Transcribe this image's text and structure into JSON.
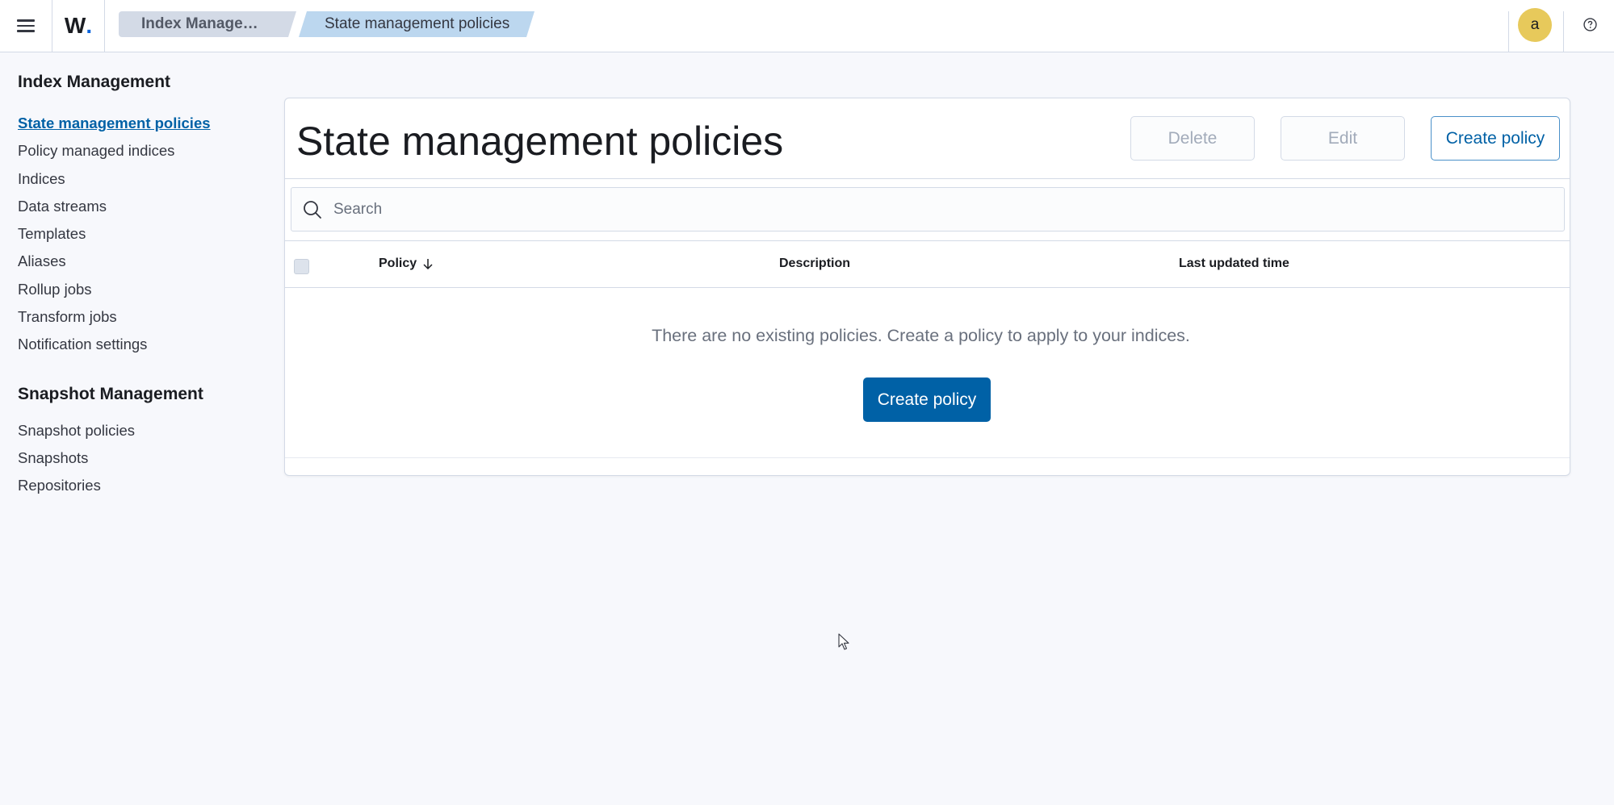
{
  "header": {
    "logo_text": "W",
    "logo_dot": ".",
    "breadcrumbs": [
      {
        "label": "Index Manage…"
      },
      {
        "label": "State management policies"
      }
    ],
    "avatar_initial": "a",
    "icons": [
      "menu-icon",
      "help-icon"
    ]
  },
  "sidebar": {
    "index_heading": "Index Management",
    "index_items": [
      {
        "label": "State management policies",
        "active": true
      },
      {
        "label": "Policy managed indices"
      },
      {
        "label": "Indices"
      },
      {
        "label": "Data streams"
      },
      {
        "label": "Templates"
      },
      {
        "label": "Aliases"
      },
      {
        "label": "Rollup jobs"
      },
      {
        "label": "Transform jobs"
      },
      {
        "label": "Notification settings"
      }
    ],
    "snapshot_heading": "Snapshot Management",
    "snapshot_items": [
      {
        "label": "Snapshot policies"
      },
      {
        "label": "Snapshots"
      },
      {
        "label": "Repositories"
      }
    ]
  },
  "main": {
    "title": "State management policies",
    "buttons": {
      "delete": "Delete",
      "edit": "Edit",
      "create": "Create policy"
    },
    "search": {
      "placeholder": "Search",
      "value": ""
    },
    "table": {
      "columns": [
        "Policy",
        "Description",
        "Last updated time"
      ],
      "sort_icon": "arrow-down-icon",
      "rows": [],
      "empty_message": "There are no existing policies. Create a policy to apply to your indices.",
      "empty_button": "Create policy"
    }
  },
  "colors": {
    "accent": "#0061a6",
    "avatar": "#e7c95b",
    "active_crumb": "#bcd7ef"
  }
}
